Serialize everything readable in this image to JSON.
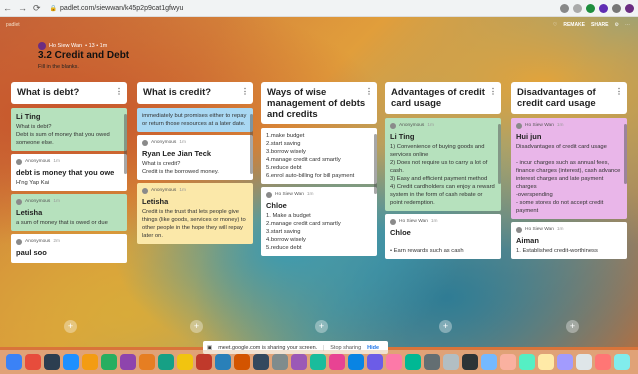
{
  "browser": {
    "url": "padlet.com/siewwan/k45p2p9cat1gfwyu"
  },
  "header": {
    "brand": "padlet",
    "author": "Ho Siew Wan",
    "meta": "• 13 • 1m",
    "title": "3.2 Credit and Debt",
    "subtitle": "Fill in the blanks.",
    "actions": [
      "REMAKE",
      "SHARE"
    ]
  },
  "columns": [
    {
      "title": "What is debt?",
      "cards": [
        {
          "color": "green",
          "author": "",
          "time": "",
          "title": "Li Ting",
          "body": "What is debt?\nDebt is sum of money that you owed someone else."
        },
        {
          "color": "white",
          "author": "Anonymous",
          "time": "1m",
          "title": "debt is money that you owe",
          "body": "H'ng Yap Kai"
        },
        {
          "color": "green",
          "author": "Anonymous",
          "time": "1m",
          "title": "Letisha",
          "body": "a sum of money that is owed or due"
        },
        {
          "color": "white",
          "author": "Anonymous",
          "time": "2m",
          "title": "paul soo",
          "body": ""
        }
      ]
    },
    {
      "title": "What is credit?",
      "cards": [
        {
          "color": "blue",
          "author": "",
          "time": "",
          "title": "",
          "body": "immediately but promises either to repay or return those resources at a later date."
        },
        {
          "color": "white",
          "author": "Anonymous",
          "time": "1m",
          "title": "Ryan Lee Jian Teck",
          "body": "What is credit?\nCredit is the borrowed money."
        },
        {
          "color": "yellow",
          "author": "Anonymous",
          "time": "1m",
          "title": "Letisha",
          "body": "Credit is the trust that lets people give things (like goods, services or money) to other people in the hope they will repay later on."
        }
      ]
    },
    {
      "title": "Ways of wise management of debts and credits",
      "cards": [
        {
          "color": "white",
          "author": "",
          "time": "",
          "title": "",
          "body": "1.make budget\n2.start saving\n3.borrow wisely\n4.manage credit card smartly\n5.reduce debt\n6.enrol auto-billing for bill payment"
        },
        {
          "color": "white",
          "author": "Ho Siew Wan",
          "time": "1m",
          "title": "Chloe",
          "body": "1. Make a budget\n2.manage credit card smartly\n3.start saving\n4.borrow wisely\n5.reduce debt"
        }
      ]
    },
    {
      "title": "Advantages of credit card usage",
      "cards": [
        {
          "color": "green",
          "author": "Anonymous",
          "time": "1m",
          "title": "Li Ting",
          "body": "1) Convenience of buying goods and services online\n2) Does not require us to carry a lot of cash.\n3) Easy and efficient payment method\n4) Credit cardholders can enjoy a reward system in the form of cash rebate or point redemption."
        },
        {
          "color": "white",
          "author": "Ho Siew Wan",
          "time": "1m",
          "title": "Chloe",
          "body": "\n• Earn rewards such as cash"
        }
      ]
    },
    {
      "title": "Disadvantages of credit card usage",
      "cards": [
        {
          "color": "purple",
          "author": "Ho Siew Wan",
          "time": "1m",
          "title": "Hui jun",
          "body": "Disadvantages of credit card usage\n\n- incur charges such as annual fees, finance charges (interest), cash advance interest charges and late payment charges\n-overspending\n- some stores do not accept credit payment"
        },
        {
          "color": "white",
          "author": "Ho Siew Wan",
          "time": "1m",
          "title": "Aiman",
          "body": "1. Established credit-worthiness"
        }
      ]
    }
  ],
  "share_banner": {
    "text": "meet.google.com is sharing your screen.",
    "stop": "Stop sharing",
    "hide": "Hide"
  }
}
